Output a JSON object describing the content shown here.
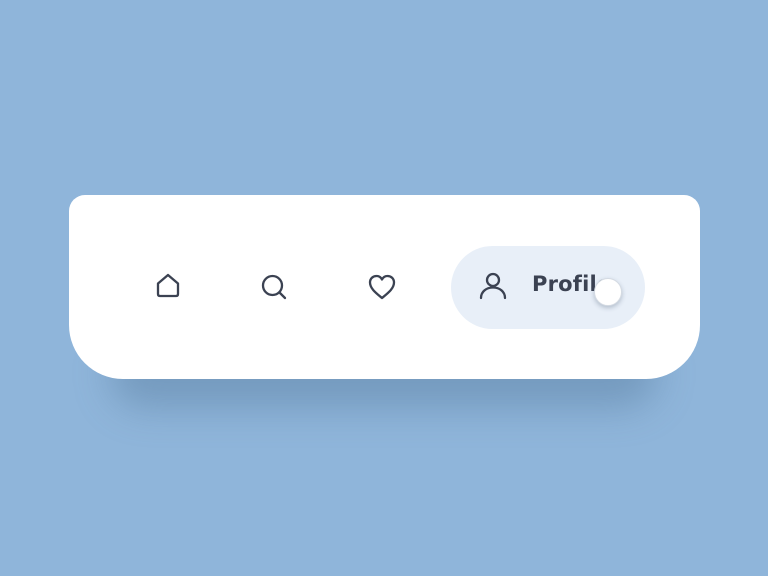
{
  "tabbar": {
    "items": [
      {
        "id": "home",
        "icon": "home-icon",
        "label": ""
      },
      {
        "id": "search",
        "icon": "search-icon",
        "label": ""
      },
      {
        "id": "favorites",
        "icon": "heart-icon",
        "label": ""
      },
      {
        "id": "profile",
        "icon": "user-icon",
        "label": "Profile",
        "active": true
      }
    ],
    "active_label": "Profile"
  },
  "colors": {
    "background": "#8fb5da",
    "bar": "#ffffff",
    "active_pill": "#e8eff8",
    "icon": "#3b4252"
  }
}
